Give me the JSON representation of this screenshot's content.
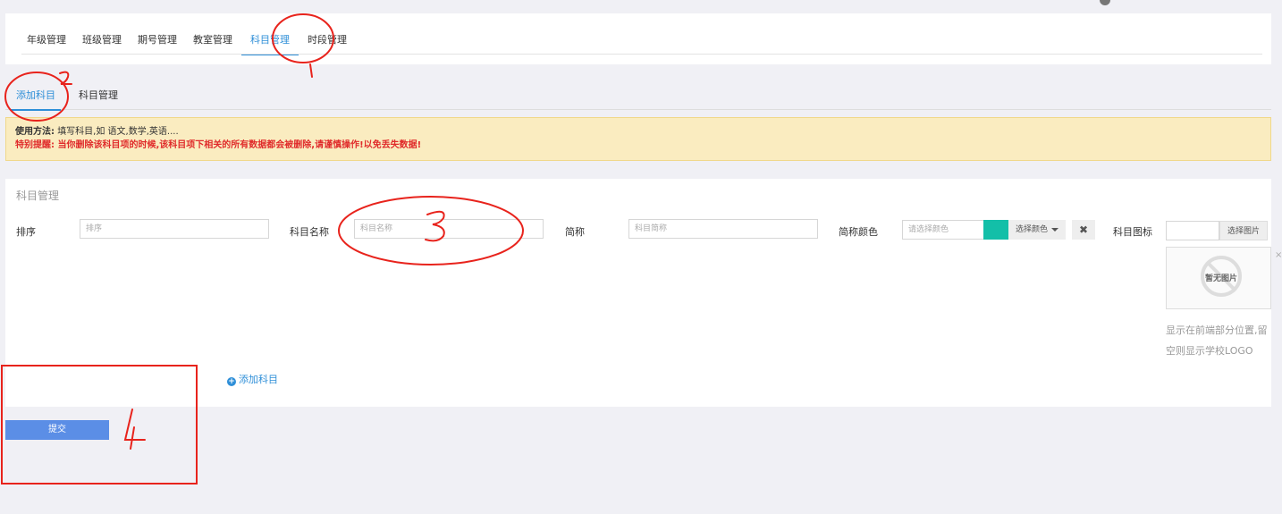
{
  "top_tabs": [
    {
      "label": "年级管理"
    },
    {
      "label": "班级管理"
    },
    {
      "label": "期号管理"
    },
    {
      "label": "教室管理"
    },
    {
      "label": "科目管理",
      "active": true
    },
    {
      "label": "时段管理"
    }
  ],
  "sub_tabs": [
    {
      "label": "添加科目",
      "active": true
    },
    {
      "label": "科目管理"
    }
  ],
  "notice": {
    "usage_label": "使用方法:",
    "usage_text": "填写科目,如 语文,数学,英语....",
    "warning": "特别提醒: 当你删除该科目项的时候,该科目项下相关的所有数据都会被删除,请谨慎操作!以免丢失数据!"
  },
  "form": {
    "title": "科目管理",
    "sort_label": "排序",
    "sort_placeholder": "排序",
    "name_label": "科目名称",
    "name_placeholder": "科目名称",
    "abbr_label": "简称",
    "abbr_placeholder": "科目简称",
    "color_label": "简称颜色",
    "color_placeholder": "请选择颜色",
    "color_value": "#13bfa8",
    "color_button": "选择颜色",
    "clear_icon": "✖",
    "icon_label": "科目图标",
    "pick_image_button": "选择图片",
    "no_image_text": "暂无图片",
    "close_icon": "×",
    "hint": "显示在前端部分位置,留空则显示学校LOGO",
    "add_subject": "添加科目",
    "add_icon": "+"
  },
  "submit_label": "提交",
  "annotations": {
    "color": "#e8231c",
    "numbers": [
      "1",
      "2",
      "3",
      "4"
    ]
  }
}
